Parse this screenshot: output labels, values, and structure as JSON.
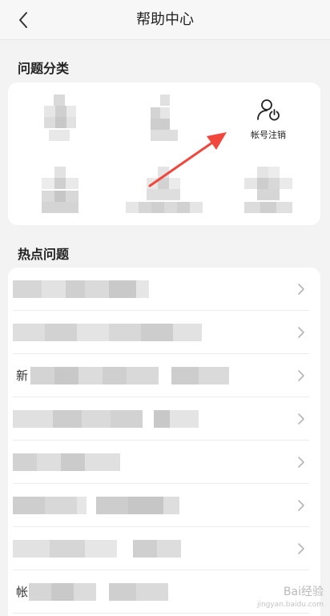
{
  "header": {
    "title": "帮助中心",
    "back_icon": "chevron-left-icon"
  },
  "sections": {
    "category_title": "问题分类",
    "hot_title": "热点问题"
  },
  "categories": [
    {
      "label": "",
      "icon": "blurred"
    },
    {
      "label": "",
      "icon": "blurred"
    },
    {
      "label": "帐号注销",
      "icon": "user-power-icon"
    },
    {
      "label": "",
      "icon": "blurred"
    },
    {
      "label": "",
      "icon": "blurred"
    },
    {
      "label": "",
      "icon": "blurred"
    }
  ],
  "hot_questions": [
    {
      "prefix": ""
    },
    {
      "prefix": ""
    },
    {
      "prefix": "新"
    },
    {
      "prefix": ""
    },
    {
      "prefix": ""
    },
    {
      "prefix": ""
    },
    {
      "prefix": ""
    },
    {
      "prefix": "帐"
    }
  ],
  "colors": {
    "background": "#f3f3f3",
    "card": "#ffffff",
    "arrow": "#f0463c",
    "text": "#222222"
  },
  "watermark": {
    "brand": "Bai经验",
    "url": "jingyan.baidu.com"
  }
}
